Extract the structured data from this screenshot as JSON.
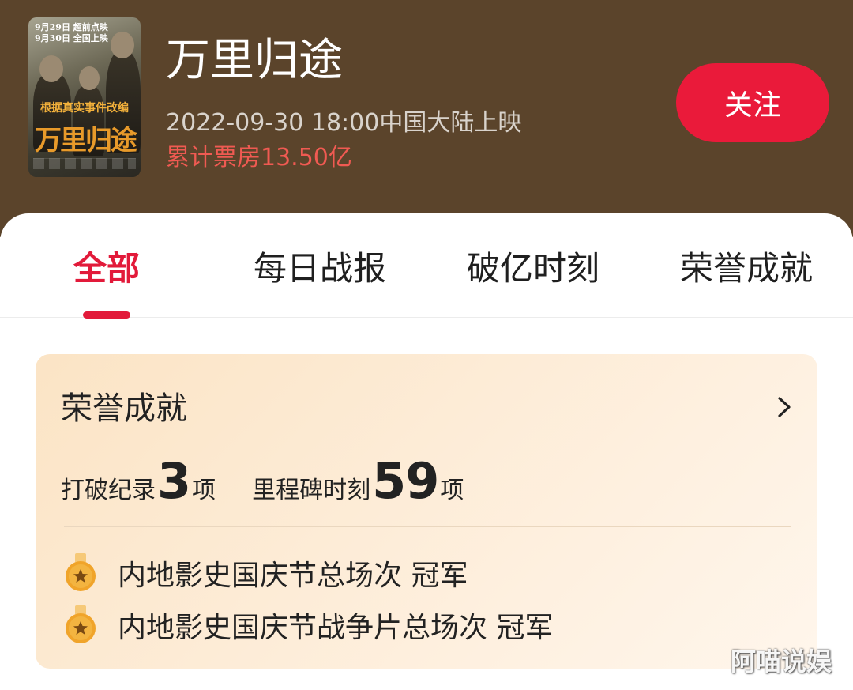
{
  "header": {
    "poster": {
      "date_line_1": "9月29日 超前点映",
      "date_line_2": "9月30日 全国上映",
      "slogan": "根据真实事件改编",
      "title": "万里归途"
    },
    "movie_title": "万里归途",
    "release_info": "2022-09-30 18:00中国大陆上映",
    "box_office": "累计票房13.50亿",
    "follow_label": "关注"
  },
  "tabs": [
    {
      "label": "全部",
      "active": true
    },
    {
      "label": "每日战报",
      "active": false
    },
    {
      "label": "破亿时刻",
      "active": false
    },
    {
      "label": "荣誉成就",
      "active": false
    }
  ],
  "honors_card": {
    "title": "荣誉成就",
    "stats": {
      "records_label": "打破纪录",
      "records_count": "3",
      "records_unit": "项",
      "milestones_label": "里程碑时刻",
      "milestones_count": "59",
      "milestones_unit": "项"
    },
    "items": [
      {
        "text": "内地影史国庆节总场次 冠军",
        "icon": "medal-icon"
      },
      {
        "text": "内地影史国庆节战争片总场次 冠军",
        "icon": "medal-icon"
      }
    ]
  },
  "watermark": "阿喵说娱",
  "colors": {
    "header_bg": "#5b442b",
    "accent_red": "#e21a3a",
    "box_office_red": "#f05a52",
    "medal_gold": "#f0a42a"
  }
}
